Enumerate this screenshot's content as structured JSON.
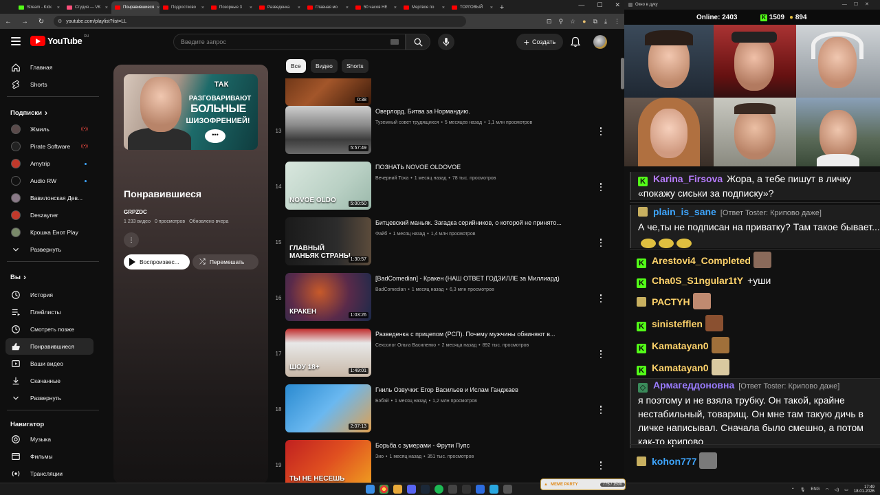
{
  "browser": {
    "tabs": [
      {
        "label": "Stream - Kick",
        "color": "#53fc18"
      },
      {
        "label": "Студия — VK",
        "color": "#ff4f7b"
      },
      {
        "label": "Понравившиеся",
        "color": "#ff0000",
        "active": true
      },
      {
        "label": "Подростково",
        "color": "#ff0000"
      },
      {
        "label": "Позорные 3",
        "color": "#ff0000"
      },
      {
        "label": "Разведенка",
        "color": "#ff0000"
      },
      {
        "label": "Главная мо",
        "color": "#ff0000"
      },
      {
        "label": "50 часов НЕ",
        "color": "#ff0000"
      },
      {
        "label": "Мертвое по",
        "color": "#ff0000"
      },
      {
        "label": "ТОРГОВЫЙ",
        "color": "#ff0000"
      }
    ],
    "new_tab": "+",
    "url": "youtube.com/playlist?list=LL"
  },
  "youtube": {
    "logo_text": "YouTube",
    "logo_region": "RU",
    "search_placeholder": "Введите запрос",
    "create_label": "Создать",
    "sidebar": {
      "main": [
        {
          "label": "Главная",
          "icon": "home-icon"
        },
        {
          "label": "Shorts",
          "icon": "shorts-icon"
        }
      ],
      "subs_header": "Подписки",
      "subs": [
        {
          "label": "Жмиль",
          "badge": "live",
          "color": "#5b4b4b"
        },
        {
          "label": "Pirate Software",
          "badge": "live",
          "color": "#222"
        },
        {
          "label": "Amytrip",
          "badge": "dot",
          "color": "#c0392b"
        },
        {
          "label": "Audio RW",
          "badge": "dot",
          "color": "#111"
        },
        {
          "label": "Вавилонская Дев...",
          "badge": "",
          "color": "#8a7a88"
        },
        {
          "label": "Deszayner",
          "badge": "",
          "color": "#c0392b"
        },
        {
          "label": "Крошка Енот Play",
          "badge": "",
          "color": "#7a8a6a"
        }
      ],
      "expand1": "Развернуть",
      "you_header": "Вы",
      "you": [
        {
          "label": "История",
          "icon": "history-icon"
        },
        {
          "label": "Плейлисты",
          "icon": "playlists-icon"
        },
        {
          "label": "Смотреть позже",
          "icon": "watch-later-icon"
        },
        {
          "label": "Понравившиеся",
          "icon": "like-icon",
          "selected": true
        },
        {
          "label": "Ваши видео",
          "icon": "your-videos-icon"
        },
        {
          "label": "Скачанные",
          "icon": "download-icon"
        }
      ],
      "expand2": "Развернуть",
      "nav_header": "Навигатор",
      "nav": [
        {
          "label": "Музыка",
          "icon": "music-icon"
        },
        {
          "label": "Фильмы",
          "icon": "movies-icon"
        },
        {
          "label": "Трансляции",
          "icon": "live-icon"
        }
      ]
    },
    "playlist": {
      "thumb_lines": [
        "ТАК",
        "РАЗГОВАРИВАЮТ",
        "БОЛЬНЫЕ",
        "ШИЗОФРЕНИЕЙ!"
      ],
      "thumb_bubble": "•••",
      "title": "Понравившиеся",
      "owner": "GRPZDC",
      "videos": "1 233 видео",
      "views": "0 просмотров",
      "updated": "Обновлено вчера",
      "play_label": "Воспроизвес...",
      "shuffle_label": "Перемешать"
    },
    "chips": [
      "Все",
      "Видео",
      "Shorts"
    ],
    "videos": [
      {
        "num": "",
        "title": "",
        "channel": "",
        "age": "",
        "views": "",
        "duration": "0:38",
        "bg": "linear-gradient(135deg,#5a2a10,#a3562a 50%,#3a1a0a)"
      },
      {
        "num": "13",
        "title": "Оверлорд. Битва за Нормандию.",
        "channel": "Туземный совет трудящихся",
        "age": "5 месяцев назад",
        "views": "1,1 млн просмотров",
        "duration": "5:57:49",
        "bg": "linear-gradient(180deg,#cfcfcf,#8a8a8a 40%,#3c3c3c 70%,#6a6a6a)"
      },
      {
        "num": "14",
        "title": "ПОЗНАТЬ NOVOE OLDOVOE",
        "channel": "Вечерний Тоха",
        "age": "1 месяц назад",
        "views": "78 тыс. просмотров",
        "duration": "5:00:50",
        "bg": "linear-gradient(135deg,#d9e7de,#b9d0c4 60%,#9ab8aa)",
        "thumb_text": "NOVOE OLDO"
      },
      {
        "num": "15",
        "title": "Битцевский маньяк. Загадка серийников, о которой не принято...",
        "channel": "Файб",
        "age": "1 месяц назад",
        "views": "1,4 млн просмотров",
        "duration": "1:30:57",
        "bg": "linear-gradient(90deg,#1a1a1a,#2c2c2c 60%,#5b4b3b)",
        "thumb_text": "ГЛАВНЫЙ МАНЬЯК СТРАНЫ"
      },
      {
        "num": "16",
        "title": "[BadComedian] - Кракен (НАШ ОТВЕТ ГОДЗИЛЛЕ за Миллиард)",
        "channel": "BadComedian",
        "age": "1 месяц назад",
        "views": "6,3 млн просмотров",
        "duration": "1:03:26",
        "bg": "radial-gradient(circle at 40% 40%,#c75a2a,#5a2a4a 50%,#1a2a4a)",
        "thumb_text": "КРАКЕН"
      },
      {
        "num": "17",
        "title": "Разведенка с прицепом (РСП). Почему мужчины обвиняют в...",
        "channel": "Сексолог Ольга Василенко",
        "age": "2 месяца назад",
        "views": "892 тыс. просмотров",
        "duration": "1:49:01",
        "bg": "linear-gradient(180deg,#c02a2a,#e8e8e8 30%,#c8b8a8)",
        "thumb_text": "ШОУ 18+"
      },
      {
        "num": "18",
        "title": "Гниль Озвучки: Егор Васильев и Ислам Ганджаев",
        "channel": "Бэбэй",
        "age": "1 месяц назад",
        "views": "1,2 млн просмотров",
        "duration": "2:07:13",
        "bg": "linear-gradient(135deg,#2a8ad0,#6ab8f0 50%,#e0a050)"
      },
      {
        "num": "19",
        "title": "Борьба с зумерами - Фрути Пупс",
        "channel": "Зио",
        "age": "1 месяц назад",
        "views": "351 тыс. просмотров",
        "duration": "",
        "bg": "linear-gradient(135deg,#c02020,#e05020 50%,#f0a020)",
        "thumb_text": "ТЫ НЕ НЕСЕШЬ"
      }
    ]
  },
  "stream": {
    "window_title": "Окно в дуку",
    "online_label": "Online:",
    "online_count": "2403",
    "kick_count": "1509",
    "coin_count": "894",
    "chat": [
      {
        "badge": "kick",
        "user": "Karina_Firsova",
        "color": "#b77cff",
        "text": "Жора, а тебе пишут в личку «покажу сиськи за подписку»?",
        "reply": ""
      },
      {
        "badge": "emote",
        "user": "plain_is_sane",
        "color": "#3ea6ff",
        "reply": "[Ответ Toster: Криповo даже]",
        "text": "А че,ты не подписан на приватку? Там такое бывает..."
      },
      {
        "badge": "kick",
        "user": "Arestovi4_Completed",
        "color": "#ffd36b",
        "text": "",
        "reply": ""
      },
      {
        "badge": "kick",
        "user": "Cha0S_S1ngular1tY",
        "color": "#ffd36b",
        "text": "+уши",
        "reply": ""
      },
      {
        "badge": "emote",
        "user": "РАСТYН",
        "color": "#ffd36b",
        "text": "",
        "reply": ""
      },
      {
        "badge": "kick",
        "user": "sinistefflen",
        "color": "#ffd36b",
        "text": "",
        "reply": ""
      },
      {
        "badge": "kick",
        "user": "Kamatayan0",
        "color": "#ffd36b",
        "text": "",
        "reply": ""
      },
      {
        "badge": "kick",
        "user": "Kamatayan0",
        "color": "#ffd36b",
        "text": "",
        "reply": ""
      },
      {
        "badge": "shield",
        "user": "Армагеддоновна",
        "color": "#9a7cff",
        "reply": "[Ответ Toster: Криповo даже]",
        "text": "я поэтому и не взяла трубку. Он такой, крайне нестабильный, товарищ. Он мне там такую дичь в личке написывал. Сначала было смешно, а потом как-то крипово"
      },
      {
        "badge": "emote",
        "user": "kohon777",
        "color": "#3ea6ff",
        "text": "",
        "reply": ""
      }
    ]
  },
  "taskbar": {
    "ticker_brand": "MEME PARTY",
    "ticker_progress": "775 / 1500",
    "lang": "ENG",
    "time": "17:49",
    "date": "18.01.2026"
  }
}
